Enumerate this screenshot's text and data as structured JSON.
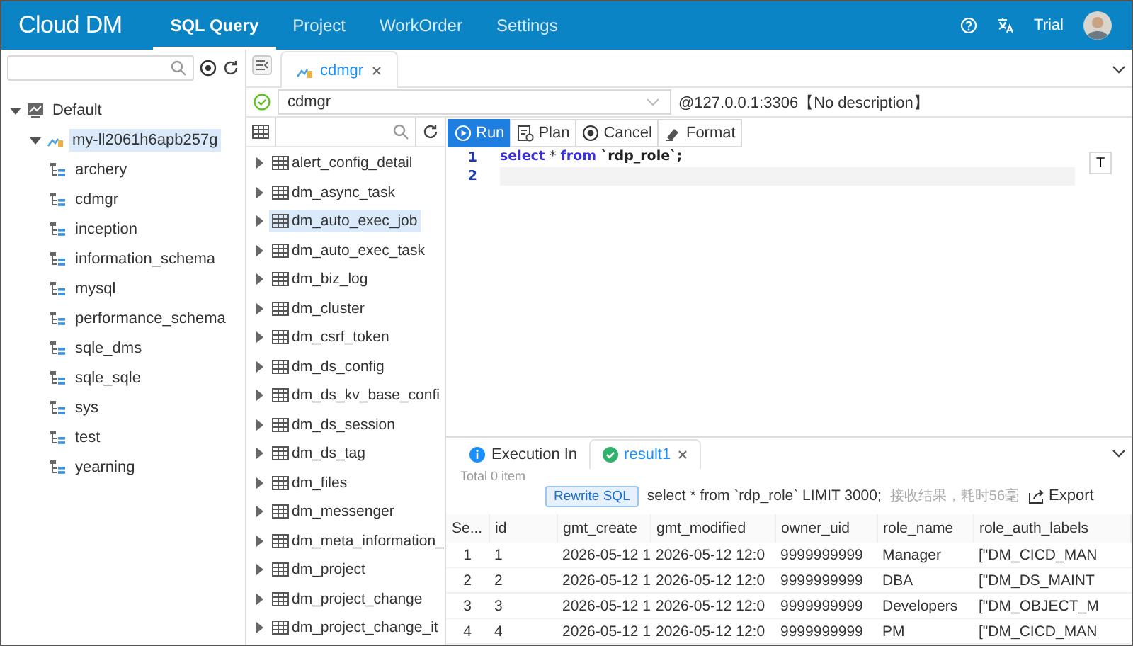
{
  "header": {
    "logo": "Cloud DM",
    "nav": [
      {
        "label": "SQL Query",
        "selected": true
      },
      {
        "label": "Project",
        "selected": false
      },
      {
        "label": "WorkOrder",
        "selected": false
      },
      {
        "label": "Settings",
        "selected": false
      }
    ],
    "user": "Trial"
  },
  "tree": [
    {
      "label": "Default",
      "kind": "group",
      "expanded": true,
      "selected": false,
      "children": [
        {
          "label": "my-ll2061h6apb257g",
          "kind": "instance",
          "expanded": true,
          "selected": true,
          "children": [
            {
              "label": "archery",
              "kind": "database"
            },
            {
              "label": "cdmgr",
              "kind": "database"
            },
            {
              "label": "inception",
              "kind": "database"
            },
            {
              "label": "information_schema",
              "kind": "database"
            },
            {
              "label": "mysql",
              "kind": "database"
            },
            {
              "label": "performance_schema",
              "kind": "database"
            },
            {
              "label": "sqle_dms",
              "kind": "database"
            },
            {
              "label": "sqle_sqle",
              "kind": "database"
            },
            {
              "label": "sys",
              "kind": "database"
            },
            {
              "label": "test",
              "kind": "database"
            },
            {
              "label": "yearning",
              "kind": "database"
            }
          ]
        }
      ]
    }
  ],
  "editor_tabs": [
    {
      "label": "cdmgr",
      "selected": true
    }
  ],
  "connection": {
    "database": "cdmgr",
    "address": "@127.0.0.1:3306【No description】"
  },
  "tables": [
    {
      "label": "alert_config_detail",
      "selected": false
    },
    {
      "label": "dm_async_task",
      "selected": false
    },
    {
      "label": "dm_auto_exec_job",
      "selected": true
    },
    {
      "label": "dm_auto_exec_task",
      "selected": false
    },
    {
      "label": "dm_biz_log",
      "selected": false
    },
    {
      "label": "dm_cluster",
      "selected": false
    },
    {
      "label": "dm_csrf_token",
      "selected": false
    },
    {
      "label": "dm_ds_config",
      "selected": false
    },
    {
      "label": "dm_ds_kv_base_confi",
      "selected": false
    },
    {
      "label": "dm_ds_session",
      "selected": false
    },
    {
      "label": "dm_ds_tag",
      "selected": false
    },
    {
      "label": "dm_files",
      "selected": false
    },
    {
      "label": "dm_messenger",
      "selected": false
    },
    {
      "label": "dm_meta_information_",
      "selected": false
    },
    {
      "label": "dm_project",
      "selected": false
    },
    {
      "label": "dm_project_change",
      "selected": false
    },
    {
      "label": "dm_project_change_it",
      "selected": false
    }
  ],
  "toolbar": [
    {
      "label": "Run",
      "kind": "run"
    },
    {
      "label": "Plan",
      "kind": "plan"
    },
    {
      "label": "Cancel",
      "kind": "cancel"
    },
    {
      "label": "Format",
      "kind": "format"
    }
  ],
  "code_lines": [
    {
      "number": "1",
      "current": false,
      "tokens": [
        {
          "text": "select",
          "kind": "keyword"
        },
        {
          "text": " * ",
          "kind": "plain"
        },
        {
          "text": "from",
          "kind": "keyword"
        },
        {
          "text": " `rdp_role`;",
          "kind": "name"
        }
      ]
    },
    {
      "number": "2",
      "current": true
    }
  ],
  "editor_side_button": "T",
  "result_tabs": [
    {
      "label": "Execution In",
      "kind": "info",
      "selected": false,
      "closable": false
    },
    {
      "label": "result1",
      "kind": "success",
      "selected": true,
      "closable": true
    }
  ],
  "result": {
    "total": "Total 0 item",
    "rewrite": "Rewrite SQL",
    "sql": "select * from `rdp_role` LIMIT 3000;",
    "note": "接收结果，耗时56毫",
    "export": "Export",
    "columns": [
      "Se...",
      "id",
      "gmt_create",
      "gmt_modified",
      "owner_uid",
      "role_name",
      "role_auth_labels"
    ],
    "rows": [
      [
        "1",
        "1",
        "2026-05-12 1",
        "2026-05-12 12:0",
        "9999999999",
        "Manager",
        "[\"DM_CICD_MAN"
      ],
      [
        "2",
        "2",
        "2026-05-12 1",
        "2026-05-12 12:0",
        "9999999999",
        "DBA",
        "[\"DM_DS_MAINT"
      ],
      [
        "3",
        "3",
        "2026-05-12 1",
        "2026-05-12 12:0",
        "9999999999",
        "Developers",
        "[\"DM_OBJECT_M"
      ],
      [
        "4",
        "4",
        "2026-05-12 1",
        "2026-05-12 12:0",
        "9999999999",
        "PM",
        "[\"DM_CICD_MAN"
      ]
    ]
  }
}
